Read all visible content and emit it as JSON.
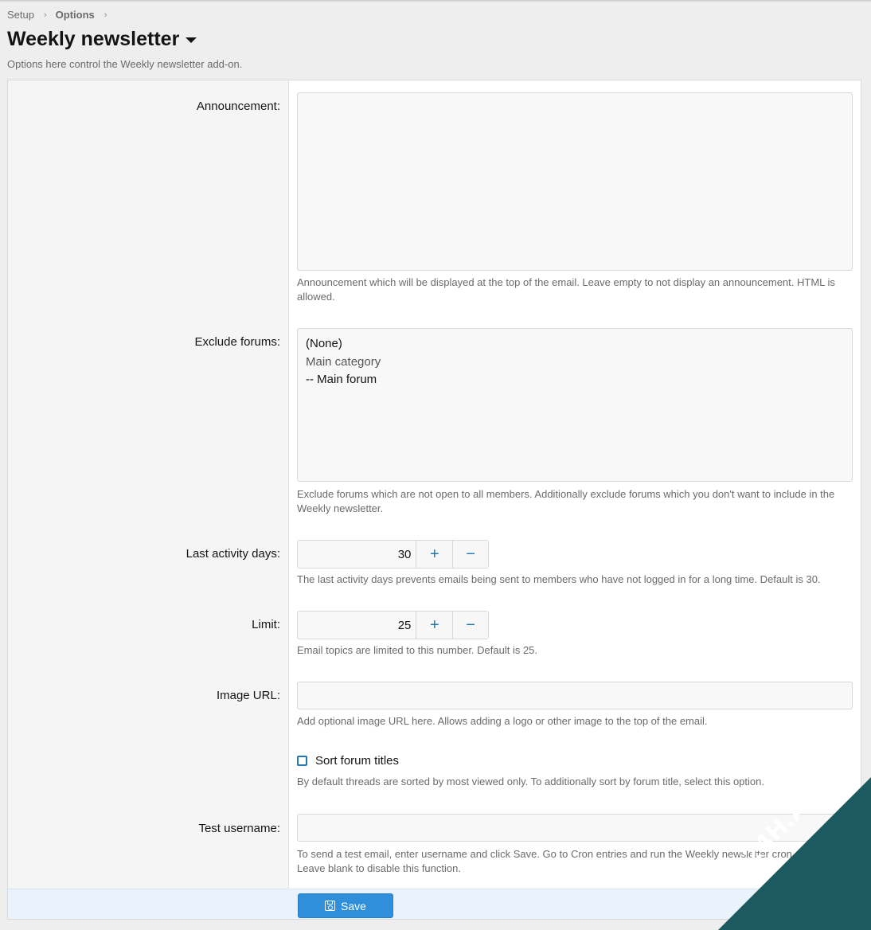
{
  "breadcrumb": {
    "items": [
      "Setup",
      "Options"
    ],
    "separator": "›"
  },
  "page": {
    "title": "Weekly newsletter",
    "description": "Options here control the Weekly newsletter add-on."
  },
  "fields": {
    "announcement": {
      "label": "Announcement:",
      "value": "",
      "hint": "Announcement which will be displayed at the top of the email. Leave empty to not display an announcement. HTML is allowed."
    },
    "exclude_forums": {
      "label": "Exclude forums:",
      "options": [
        "(None)",
        "Main category",
        "-- Main forum"
      ],
      "hint": "Exclude forums which are not open to all members. Additionally exclude forums which you don't want to include in the Weekly newsletter."
    },
    "last_activity_days": {
      "label": "Last activity days:",
      "value": "30",
      "hint": "The last activity days prevents emails being sent to members who have not logged in for a long time. Default is 30."
    },
    "limit": {
      "label": "Limit:",
      "value": "25",
      "hint": "Email topics are limited to this number. Default is 25."
    },
    "image_url": {
      "label": "Image URL:",
      "value": "",
      "hint": "Add optional image URL here. Allows adding a logo or other image to the top of the email."
    },
    "sort_forum_titles": {
      "label": "Sort forum titles",
      "checked": false,
      "hint": "By default threads are sorted by most viewed only. To additionally sort by forum title, select this option."
    },
    "test_username": {
      "label": "Test username:",
      "value": "",
      "hint_line1": "To send a test email, enter username and click Save. Go to Cron entries and run the Weekly newsletter cron entry.",
      "hint_line2": "Leave blank to disable this function."
    }
  },
  "stepper": {
    "plus": "+",
    "minus": "−"
  },
  "actions": {
    "save_label": "Save"
  },
  "watermark": {
    "text": "24H.AEtot.Net"
  },
  "colors": {
    "accent": "#2f8fdb",
    "icon_blue": "#2577b1",
    "footer_bg": "#eaf3fb"
  }
}
